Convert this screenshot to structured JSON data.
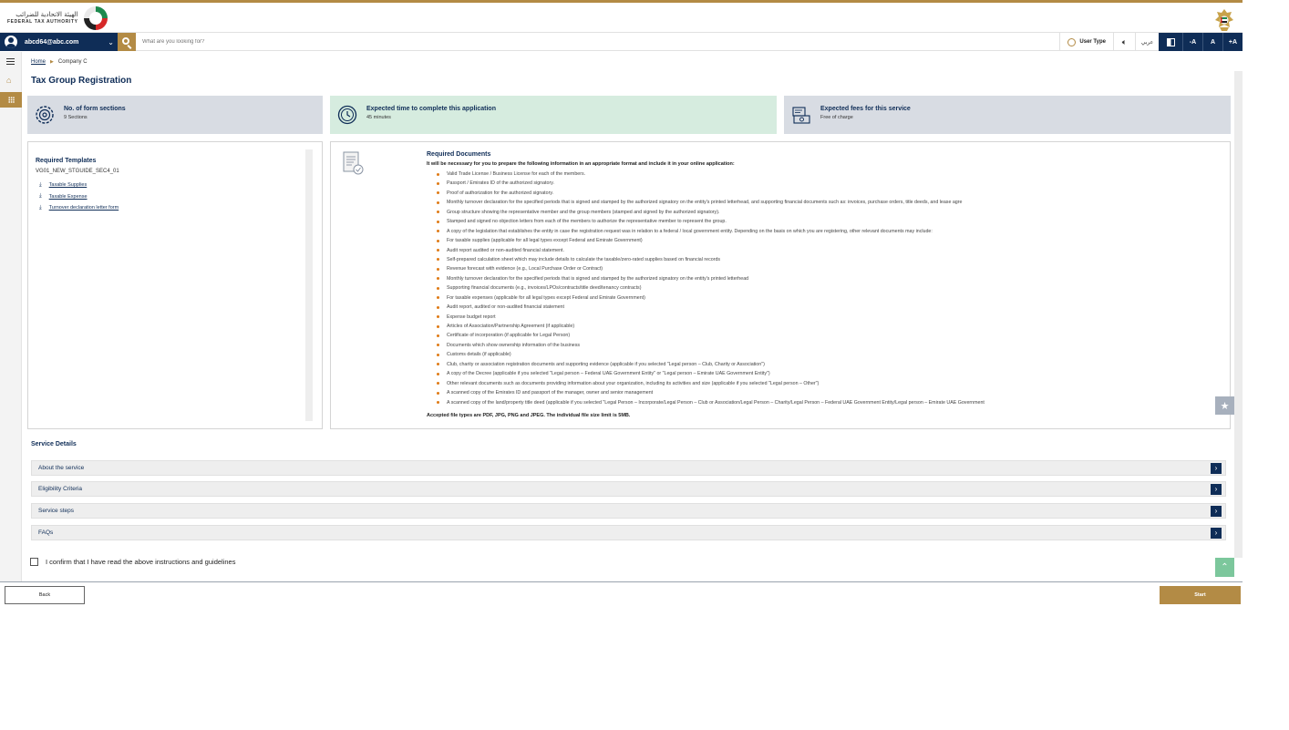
{
  "header": {
    "logo_arabic": "الهيئة الاتحادية للضرائب",
    "logo_english": "FEDERAL TAX AUTHORITY"
  },
  "topbar": {
    "user_email": "abcd64@abc.com",
    "search_placeholder": "What are you looking for?",
    "user_type_label": "User Type",
    "language_label": "عربي",
    "font_decrease": "-A",
    "font_reset": "A",
    "font_increase": "+A"
  },
  "breadcrumb": {
    "home": "Home",
    "current": "Company C"
  },
  "page_title": "Tax Group Registration",
  "info_cards": [
    {
      "title": "No. of form sections",
      "value": "9 Sections",
      "icon": "gear-icon"
    },
    {
      "title": "Expected time to complete this application",
      "value": "45 minutes",
      "icon": "clock-icon"
    },
    {
      "title": "Expected fees for this service",
      "value": "Free of charge",
      "icon": "money-icon"
    }
  ],
  "templates": {
    "title": "Required Templates",
    "code": "VG01_NEW_STGUIDE_SEC4_01",
    "items": [
      "Taxable Supplies",
      "Taxable Expense",
      "Turnover declaration letter form"
    ]
  },
  "required_documents": {
    "title": "Required Documents",
    "intro": "It will be necessary for you to prepare the following information in an appropriate format and include it in your online application:",
    "items": [
      "Valid Trade License / Business License for each of the members.",
      "Passport / Emirates ID of the authorized signatory.",
      "Proof of authorization for the authorized signatory.",
      "Monthly turnover declaration for the specified periods that is signed and stamped by the authorized signatory on the entity's printed letterhead, and supporting financial documents such as: invoices, purchase orders, title deeds, and lease agre",
      "Group structure showing the representative member and the group members (stamped and signed by the authorized signatory).",
      "Stamped and signed no objection letters from each of the members to authorize the representative member to represent the group.",
      "A copy of the legislation that establishes the entity in case the registration request was in relation to a federal / local government entity. Depending on the basis on which you are registering, other relevant documents may include:",
      "For taxable supplies (applicable for all legal types except Federal and Emirate Government)",
      "Audit report audited or non-audited financial statement.",
      "Self-prepared calculation sheet which may include details to calculate the taxable/zero-rated supplies based on financial records",
      "Revenue forecast with evidence (e.g., Local Purchase Order or Contract)",
      "Monthly turnover declaration for the specified periods that is signed and stamped by the authorized signatory on the entity's printed letterhead",
      "Supporting financial documents (e.g., invoices/LPOs/contracts/title deed/tenancy contracts)",
      "For taxable expenses (applicable for all legal types except Federal and Emirate Government)",
      "Audit report, audited or non-audited financial statement",
      "Expense budget report",
      "Articles of Association/Partnership Agreement (if applicable)",
      "Certificate of incorporation (if applicable for Legal Person)",
      "Documents which show ownership information of the business",
      "Customs details (if applicable)",
      "Club, charity or association registration documents and supporting evidence (applicable if you selected \"Legal person – Club, Charity or Association\")",
      "A copy of the Decree (applicable if you selected \"Legal person – Federal UAE Government Entity\" or \"Legal person – Emirate UAE Government Entity\")",
      "Other relevant documents such as documents providing information about your organization, including its activities and size (applicable if you selected \"Legal person – Other\")",
      "A scanned copy of the Emirates ID and passport of the manager, owner and senior management",
      "A scanned copy of the land/property title deed (applicable if you selected \"Legal Person – Incorporate/Legal Person – Club or Association/Legal Person – Charity/Legal Person – Federal UAE Government Entity/Legal person – Emirate UAE Government"
    ],
    "footnote": "Accepted file types are PDF, JPG, PNG and JPEG. The individual file size limit is 5MB."
  },
  "service_details": {
    "title": "Service Details",
    "sections": [
      "About the service",
      "Eligibility Criteria",
      "Service steps",
      "FAQs"
    ]
  },
  "confirm_label": "I confirm that I have read the above instructions and guidelines",
  "footer": {
    "back_label": "Back",
    "start_label": "Start"
  },
  "colors": {
    "navy": "#0f2d57",
    "gold": "#b38b45",
    "card_grey": "#d8dce3",
    "card_green": "#d6ecdf",
    "bullet_orange": "#e07b16"
  }
}
